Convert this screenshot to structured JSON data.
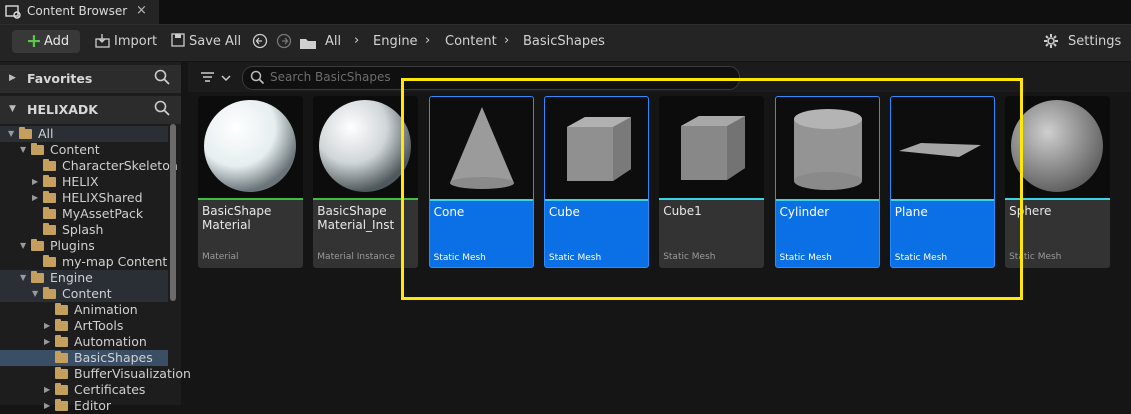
{
  "tab": {
    "title": "Content Browser",
    "close": "×"
  },
  "toolbar": {
    "add_label": "Add",
    "import_label": "Import",
    "save_all_label": "Save All",
    "settings_label": "Settings"
  },
  "breadcrumb": [
    "All",
    "Engine",
    "Content",
    "BasicShapes"
  ],
  "sidebar": {
    "favorites": "Favorites",
    "project": "HELIXADK",
    "tree": [
      {
        "label": "All",
        "depth": 0,
        "expanded": true
      },
      {
        "label": "Content",
        "depth": 1,
        "expanded": true
      },
      {
        "label": "CharacterSkeleton",
        "depth": 2
      },
      {
        "label": "HELIX",
        "depth": 2,
        "collapsed": true
      },
      {
        "label": "HELIXShared",
        "depth": 2,
        "collapsed": true
      },
      {
        "label": "MyAssetPack",
        "depth": 2
      },
      {
        "label": "Splash",
        "depth": 2
      },
      {
        "label": "Plugins",
        "depth": 1,
        "expanded": true
      },
      {
        "label": "my-map Content",
        "depth": 2
      },
      {
        "label": "Engine",
        "depth": 1,
        "expanded": true
      },
      {
        "label": "Content",
        "depth": 2,
        "expanded": true
      },
      {
        "label": "Animation",
        "depth": 3
      },
      {
        "label": "ArtTools",
        "depth": 3,
        "collapsed": true
      },
      {
        "label": "Automation",
        "depth": 3,
        "collapsed": true
      },
      {
        "label": "BasicShapes",
        "depth": 3,
        "selected": true
      },
      {
        "label": "BufferVisualization",
        "depth": 3
      },
      {
        "label": "Certificates",
        "depth": 3,
        "collapsed": true
      },
      {
        "label": "Editor",
        "depth": 3,
        "collapsed": true
      }
    ]
  },
  "search": {
    "placeholder": "Search BasicShapes"
  },
  "assets": [
    {
      "name": "BasicShape Material",
      "type": "Material",
      "selected": false
    },
    {
      "name": "BasicShape Material_Inst",
      "type": "Material Instance",
      "selected": false
    },
    {
      "name": "Cone",
      "type": "Static Mesh",
      "selected": true
    },
    {
      "name": "Cube",
      "type": "Static Mesh",
      "selected": true
    },
    {
      "name": "Cube1",
      "type": "Static Mesh",
      "selected": false
    },
    {
      "name": "Cylinder",
      "type": "Static Mesh",
      "selected": true
    },
    {
      "name": "Plane",
      "type": "Static Mesh",
      "selected": true
    },
    {
      "name": "Sphere",
      "type": "Static Mesh",
      "selected": false
    }
  ],
  "colors": {
    "selected": "#0b6fe6",
    "highlight": "#ffe70a",
    "material_bar": "#3fbf3f",
    "mesh_bar": "#3ad4e6"
  }
}
